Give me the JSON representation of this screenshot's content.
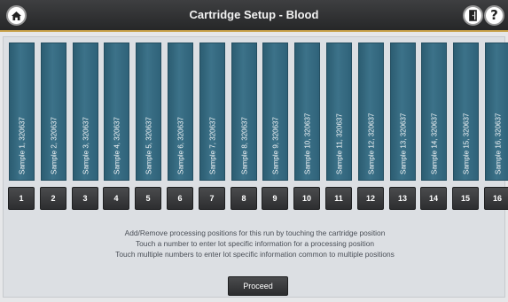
{
  "header": {
    "title": "Cartridge Setup - Blood",
    "help_symbol": "?"
  },
  "icons": {
    "home": "home-icon",
    "exit": "door-icon",
    "help": "help-icon"
  },
  "colors": {
    "titlebar": "#262728",
    "accent_line": "#c9a24a",
    "slot_fill": "#3c7289",
    "number_button": "#2d2e30",
    "panel": "#dcdfe3"
  },
  "slots": [
    {
      "label": "Sample 1, 320637",
      "number": "1"
    },
    {
      "label": "Sample 2, 320637",
      "number": "2"
    },
    {
      "label": "Sample 3, 320637",
      "number": "3"
    },
    {
      "label": "Sample 4, 320637",
      "number": "4"
    },
    {
      "label": "Sample 5, 320637",
      "number": "5"
    },
    {
      "label": "Sample 6, 320637",
      "number": "6"
    },
    {
      "label": "Sample 7, 320637",
      "number": "7"
    },
    {
      "label": "Sample 8, 320637",
      "number": "8"
    },
    {
      "label": "Sample 9, 320637",
      "number": "9"
    },
    {
      "label": "Sample 10, 320637",
      "number": "10"
    },
    {
      "label": "Sample 11, 320637",
      "number": "11"
    },
    {
      "label": "Sample 12, 320637",
      "number": "12"
    },
    {
      "label": "Sample 13, 320637",
      "number": "13"
    },
    {
      "label": "Sample 14, 320637",
      "number": "14"
    },
    {
      "label": "Sample 15, 320637",
      "number": "15"
    },
    {
      "label": "Sample 16, 320637",
      "number": "16"
    }
  ],
  "instructions": [
    "Add/Remove processing positions for this run by touching the cartridge position",
    "Touch a number to enter lot specific information for a processing position",
    "Touch multiple numbers to enter lot specific information common to multiple positions"
  ],
  "proceed_label": "Proceed"
}
